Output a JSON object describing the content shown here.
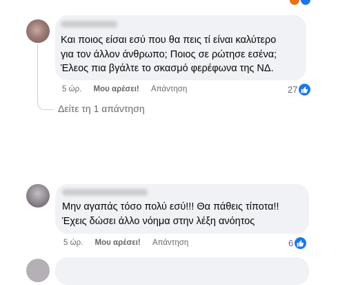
{
  "comments": [
    {
      "text_lines": [
        "Και ποιος είσαι εσύ που θα πεις τί είναι καλύτερο",
        "για τον άλλον άνθρωπο; Ποιος σε ρώτησε εσένα;",
        "Έλεος πια βγάλτε το σκασμό φερέφωνα της ΝΔ."
      ],
      "time": "5 ώρ.",
      "like_label": "Μου αρέσει!",
      "reply_label": "Απάντηση",
      "reaction_count": "27"
    },
    {
      "text_lines": [
        "Μην αγαπάς τόσο πολύ εσύ!!! Θα πάθεις τίποτα!!",
        "Έχεις δώσει άλλο νόημα στην λέξη ανόητος"
      ],
      "time": "5 ώρ.",
      "like_label": "Μου αρέσει!",
      "reply_label": "Απάντηση",
      "reaction_count": "6"
    }
  ],
  "view_replies_label": "Δείτε τη 1 απάντηση",
  "colors": {
    "like_blue": "#1877f2",
    "bubble_bg": "#f0f2f5",
    "meta_gray": "#65676b"
  },
  "icons": [
    "like-icon",
    "thread-connector"
  ]
}
